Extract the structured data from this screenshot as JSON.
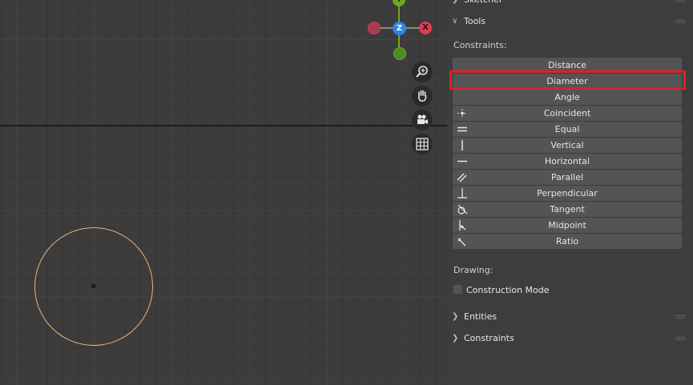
{
  "panel": {
    "sketcher_header": "Sketcher",
    "tools_header": "Tools",
    "constraints_label": "Constraints:",
    "constraint_buttons": [
      {
        "label": "Distance",
        "icon": ""
      },
      {
        "label": "Diameter",
        "icon": ""
      },
      {
        "label": "Angle",
        "icon": ""
      },
      {
        "label": "Coincident",
        "icon": "coincident-icon"
      },
      {
        "label": "Equal",
        "icon": "equal-icon"
      },
      {
        "label": "Vertical",
        "icon": "vertical-icon"
      },
      {
        "label": "Horizontal",
        "icon": "horizontal-icon"
      },
      {
        "label": "Parallel",
        "icon": "parallel-icon"
      },
      {
        "label": "Perpendicular",
        "icon": "perpendicular-icon"
      },
      {
        "label": "Tangent",
        "icon": "tangent-icon"
      },
      {
        "label": "Midpoint",
        "icon": "midpoint-icon"
      },
      {
        "label": "Ratio",
        "icon": "ratio-icon"
      }
    ],
    "highlighted_button": "Diameter",
    "drawing_label": "Drawing:",
    "construction_mode_label": "Construction Mode",
    "construction_mode_checked": false,
    "entities_header": "Entities",
    "constraints_header": "Constraints"
  },
  "gizmo": {
    "y_label": "Y",
    "z_label": "Z",
    "x_label": "X",
    "x_color": "#e3394f",
    "y_color": "#6fa822",
    "z_color": "#2f86e0"
  },
  "nav_buttons": [
    "zoom-icon",
    "hand-pan-icon",
    "camera-icon",
    "grid-ortho-icon"
  ],
  "colors": {
    "highlight": "#e01f26",
    "sketch_circle": "#e9b27a"
  }
}
